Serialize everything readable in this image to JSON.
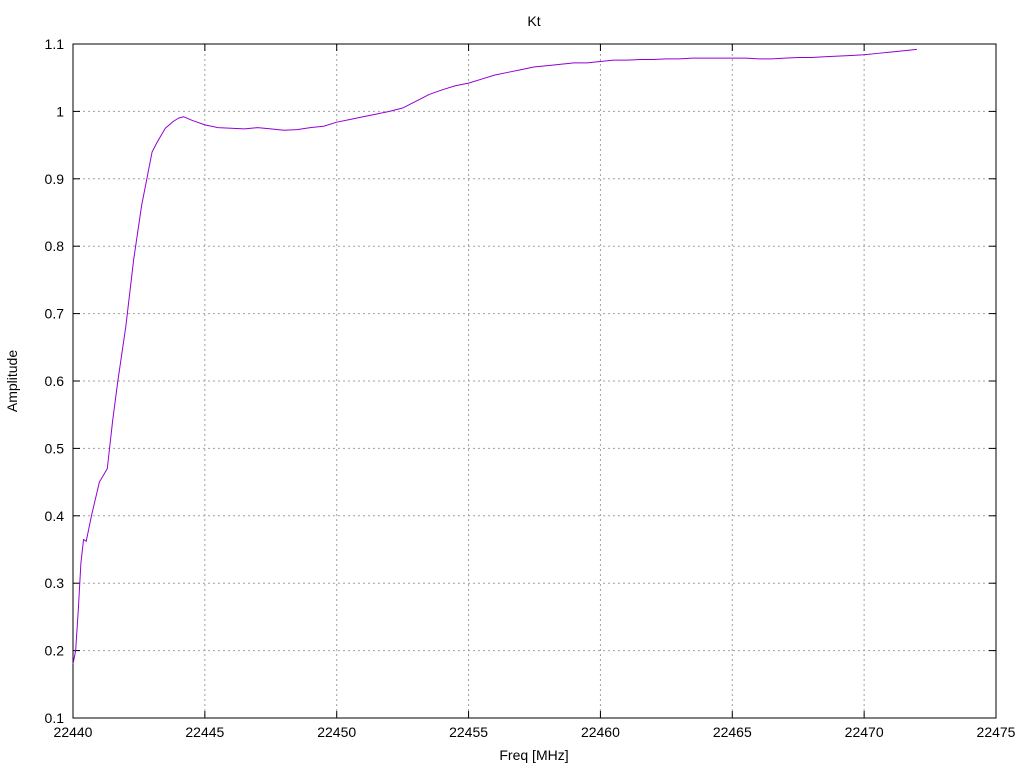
{
  "chart_data": {
    "type": "line",
    "title": "Kt",
    "xlabel": "Freq [MHz]",
    "ylabel": "Amplitude",
    "xlim": [
      22440,
      22475
    ],
    "ylim": [
      0.1,
      1.1
    ],
    "xticks": [
      22440,
      22445,
      22450,
      22455,
      22460,
      22465,
      22470,
      22475
    ],
    "yticks": [
      0.1,
      0.2,
      0.3,
      0.4,
      0.5,
      0.6,
      0.7,
      0.8,
      0.9,
      1,
      1.1
    ],
    "xtick_labels": [
      "22440",
      "22445",
      "22450",
      "22455",
      "22460",
      "22465",
      "22470",
      "22475"
    ],
    "ytick_labels": [
      "0.1",
      "0.2",
      "0.3",
      "0.4",
      "0.5",
      "0.6",
      "0.7",
      "0.8",
      "0.9",
      "1",
      "1.1"
    ],
    "grid": true,
    "legend": "none",
    "series": [
      {
        "color": "#9400d3",
        "x": [
          22440.0,
          22440.1,
          22440.2,
          22440.3,
          22440.4,
          22440.5,
          22440.7,
          22441.0,
          22441.3,
          22441.5,
          22441.7,
          22442.0,
          22442.3,
          22442.6,
          22442.8,
          22443.0,
          22443.2,
          22443.5,
          22443.8,
          22444.0,
          22444.2,
          22444.5,
          22445.0,
          22445.5,
          22446.0,
          22446.5,
          22447.0,
          22447.5,
          22448.0,
          22448.5,
          22449.0,
          22449.5,
          22450.0,
          22450.5,
          22451.0,
          22451.5,
          22452.0,
          22452.5,
          22453.0,
          22453.5,
          22454.0,
          22454.5,
          22455.0,
          22455.5,
          22456.0,
          22456.5,
          22457.0,
          22457.5,
          22458.0,
          22458.5,
          22459.0,
          22459.5,
          22460.0,
          22460.5,
          22461.0,
          22461.5,
          22462.0,
          22462.5,
          22463.0,
          22463.5,
          22464.0,
          22464.5,
          22465.0,
          22465.5,
          22466.0,
          22466.5,
          22467.0,
          22467.5,
          22468.0,
          22468.5,
          22469.0,
          22469.5,
          22470.0,
          22470.5,
          22471.0,
          22471.5,
          22472.0
        ],
        "y": [
          0.18,
          0.2,
          0.26,
          0.33,
          0.365,
          0.362,
          0.4,
          0.45,
          0.47,
          0.54,
          0.6,
          0.68,
          0.78,
          0.86,
          0.9,
          0.94,
          0.955,
          0.975,
          0.985,
          0.99,
          0.992,
          0.987,
          0.98,
          0.976,
          0.975,
          0.974,
          0.976,
          0.974,
          0.972,
          0.973,
          0.976,
          0.978,
          0.984,
          0.988,
          0.992,
          0.996,
          1.0,
          1.005,
          1.015,
          1.025,
          1.032,
          1.038,
          1.042,
          1.048,
          1.054,
          1.058,
          1.062,
          1.066,
          1.068,
          1.07,
          1.072,
          1.072,
          1.074,
          1.076,
          1.076,
          1.077,
          1.077,
          1.078,
          1.078,
          1.079,
          1.079,
          1.079,
          1.079,
          1.079,
          1.078,
          1.078,
          1.079,
          1.08,
          1.08,
          1.081,
          1.082,
          1.083,
          1.084,
          1.086,
          1.088,
          1.09,
          1.092
        ]
      }
    ]
  }
}
